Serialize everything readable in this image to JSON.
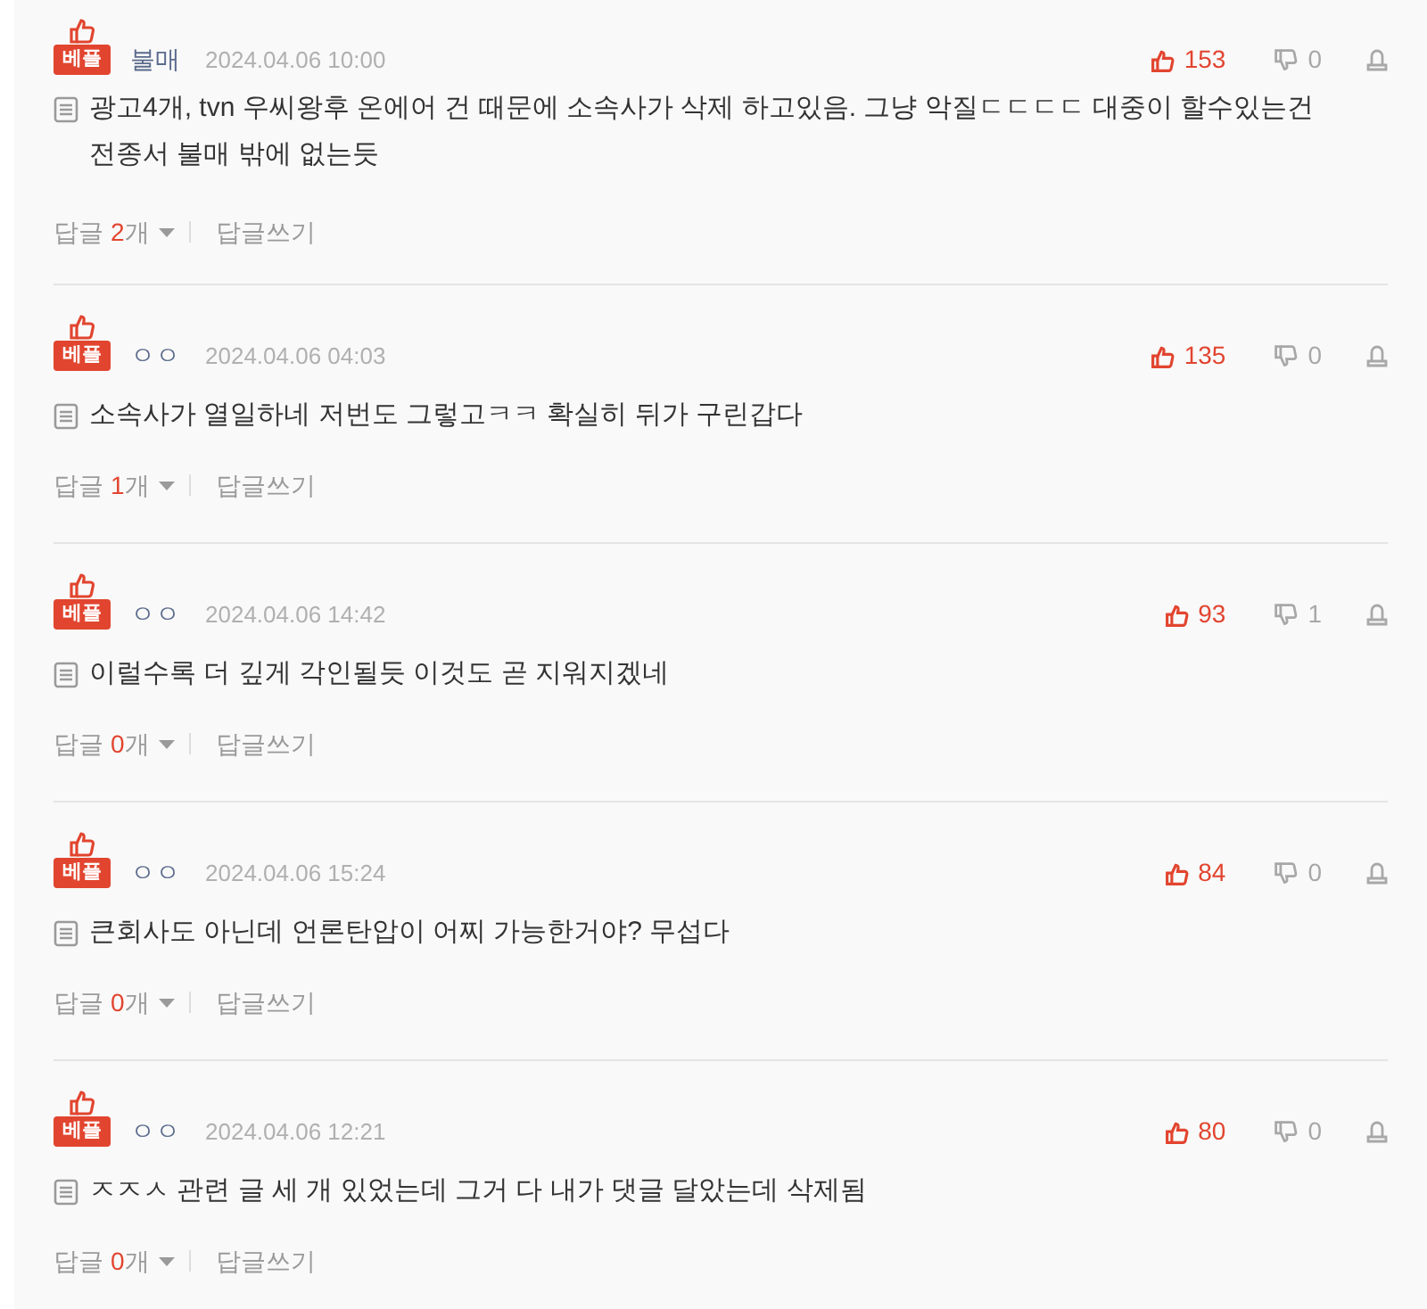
{
  "comments": [
    {
      "badge": "베플",
      "author": "불매",
      "date": "2024.04.06 10:00",
      "likes": "153",
      "dislikes": "0",
      "text": "광고4개, tvn 우씨왕후 온에어 건 때문에 소속사가 삭제 하고있음. 그냥 악질ㄷㄷㄷㄷ 대중이 할수있는건 전종서 불매 밖에 없는듯",
      "replies": {
        "label": "답글",
        "count": "2",
        "unit": "개"
      },
      "write_reply": "답글쓰기"
    },
    {
      "badge": "베플",
      "author": "ㅇㅇ",
      "date": "2024.04.06 04:03",
      "likes": "135",
      "dislikes": "0",
      "text": "소속사가 열일하네 저번도 그렇고ㅋㅋ 확실히 뒤가 구린갑다",
      "replies": {
        "label": "답글",
        "count": "1",
        "unit": "개"
      },
      "write_reply": "답글쓰기"
    },
    {
      "badge": "베플",
      "author": "ㅇㅇ",
      "date": "2024.04.06 14:42",
      "likes": "93",
      "dislikes": "1",
      "text": "이럴수록 더 깊게 각인될듯 이것도 곧 지워지겠네",
      "replies": {
        "label": "답글",
        "count": "0",
        "unit": "개"
      },
      "write_reply": "답글쓰기"
    },
    {
      "badge": "베플",
      "author": "ㅇㅇ",
      "date": "2024.04.06 15:24",
      "likes": "84",
      "dislikes": "0",
      "text": "큰회사도 아닌데 언론탄압이 어찌 가능한거야? 무섭다",
      "replies": {
        "label": "답글",
        "count": "0",
        "unit": "개"
      },
      "write_reply": "답글쓰기"
    },
    {
      "badge": "베플",
      "author": "ㅇㅇ",
      "date": "2024.04.06 12:21",
      "likes": "80",
      "dislikes": "0",
      "text": "ㅈㅈㅅ 관련 글 세 개 있었는데 그거 다 내가 댓글 달았는데 삭제됨",
      "replies": {
        "label": "답글",
        "count": "0",
        "unit": "개"
      },
      "write_reply": "답글쓰기"
    }
  ]
}
